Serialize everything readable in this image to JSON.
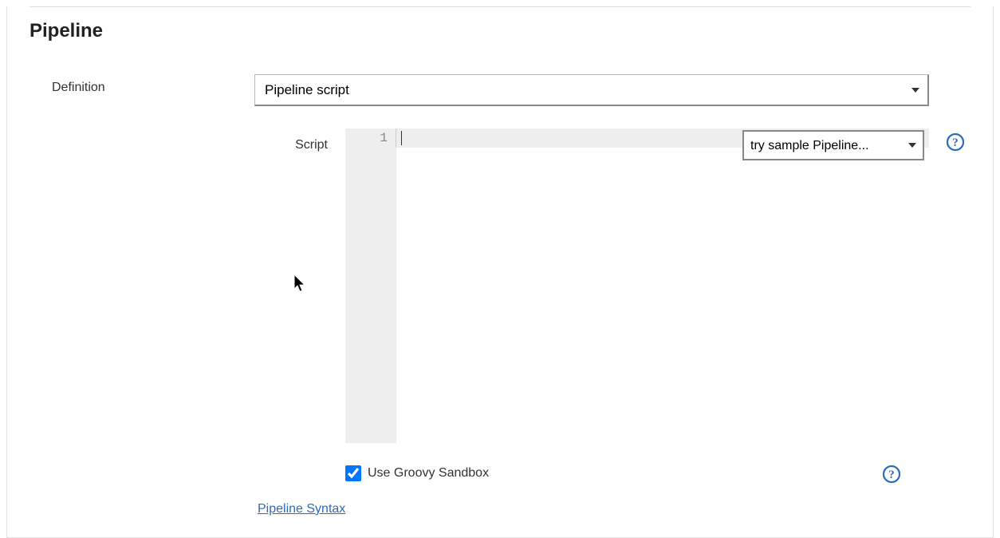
{
  "section": {
    "title": "Pipeline"
  },
  "definition": {
    "label": "Definition",
    "value": "Pipeline script"
  },
  "script": {
    "label": "Script",
    "line_number": "1",
    "sample_dropdown": "try sample Pipeline..."
  },
  "sandbox": {
    "checked": true,
    "label": "Use Groovy Sandbox"
  },
  "syntax_link": {
    "label": "Pipeline Syntax"
  },
  "help_icon_title": "Help"
}
